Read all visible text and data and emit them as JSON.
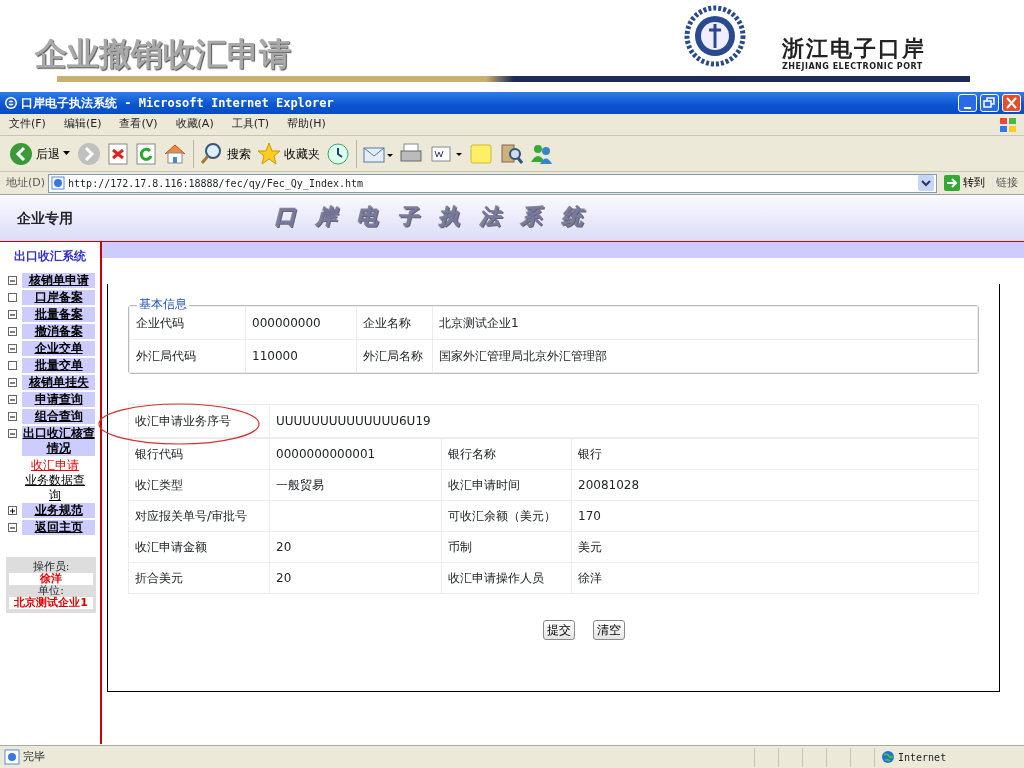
{
  "slide": {
    "title": "企业撤销收汇申请",
    "logo_text": "浙江电子口岸",
    "logo_subtitle": "ZHEJIANG ELECTRONIC PORT"
  },
  "window": {
    "title": "口岸电子执法系统 - Microsoft Internet Explorer"
  },
  "menu": [
    "文件(F)",
    "编辑(E)",
    "查看(V)",
    "收藏(A)",
    "工具(T)",
    "帮助(H)"
  ],
  "toolbar": [
    {
      "kind": "back",
      "label": "后退"
    },
    {
      "kind": "forward"
    },
    {
      "kind": "stop"
    },
    {
      "kind": "refresh"
    },
    {
      "kind": "home"
    },
    {
      "kind": "search",
      "label": "搜索"
    },
    {
      "kind": "favorites",
      "label": "收藏夹"
    },
    {
      "kind": "history"
    },
    {
      "kind": "mail"
    },
    {
      "kind": "print"
    },
    {
      "kind": "edit"
    },
    {
      "kind": "notes"
    },
    {
      "kind": "research"
    },
    {
      "kind": "messenger"
    }
  ],
  "address": {
    "label": "地址(D)",
    "url": "http://172.17.8.116:18888/fec/qy/Fec_Qy_Index.htm",
    "go": "转到",
    "links": "链接"
  },
  "page": {
    "side_title": "企业专用",
    "banner": "口岸电子执法系统",
    "sidebar": {
      "title": "出口收汇系统",
      "items": [
        {
          "label": "核销单申请",
          "kind": "minus"
        },
        {
          "label": "口岸备案",
          "kind": "empty"
        },
        {
          "label": "批量备案",
          "kind": "minus"
        },
        {
          "label": "撤消备案",
          "kind": "minus"
        },
        {
          "label": "企业交单",
          "kind": "minus"
        },
        {
          "label": "批量交单",
          "kind": "empty"
        },
        {
          "label": "核销单挂失",
          "kind": "minus"
        },
        {
          "label": "申请查询",
          "kind": "minus"
        },
        {
          "label": "组合查询",
          "kind": "minus"
        },
        {
          "label": "出口收汇核查情况",
          "kind": "minus",
          "children": [
            {
              "label": "收汇申请",
              "selected": true
            },
            {
              "label": "业务数据查询",
              "selected": false
            }
          ]
        },
        {
          "label": "业务规范",
          "kind": "plus"
        },
        {
          "label": "返回主页",
          "kind": "minus"
        }
      ],
      "operator_label": "操作员:",
      "operator": "徐洋",
      "unit_label": "单位:",
      "unit": "北京测试企业1"
    },
    "basic_info": {
      "legend": "基本信息",
      "rows": [
        [
          "企业代码",
          "000000000",
          "企业名称",
          "北京测试企业1"
        ],
        [
          "外汇局代码",
          "110000",
          "外汇局名称",
          "国家外汇管理局北京外汇管理部"
        ]
      ]
    },
    "detail": {
      "serial_label": "收汇申请业务序号",
      "serial_value": "UUUUUUUUUUUUUU6U19",
      "rows": [
        [
          "银行代码",
          "0000000000001",
          "银行名称",
          "银行"
        ],
        [
          "收汇类型",
          "一般贸易",
          "收汇申请时间",
          "20081028"
        ],
        [
          "对应报关单号/审批号",
          "",
          "可收汇余额（美元）",
          "170"
        ],
        [
          "收汇申请金额",
          "20",
          "币制",
          "美元"
        ],
        [
          "折合美元",
          "20",
          "收汇申请操作人员",
          "徐洋"
        ]
      ]
    },
    "buttons": [
      "提交",
      "清空"
    ]
  },
  "status_bar": {
    "text": "完毕",
    "zone": "Internet"
  }
}
